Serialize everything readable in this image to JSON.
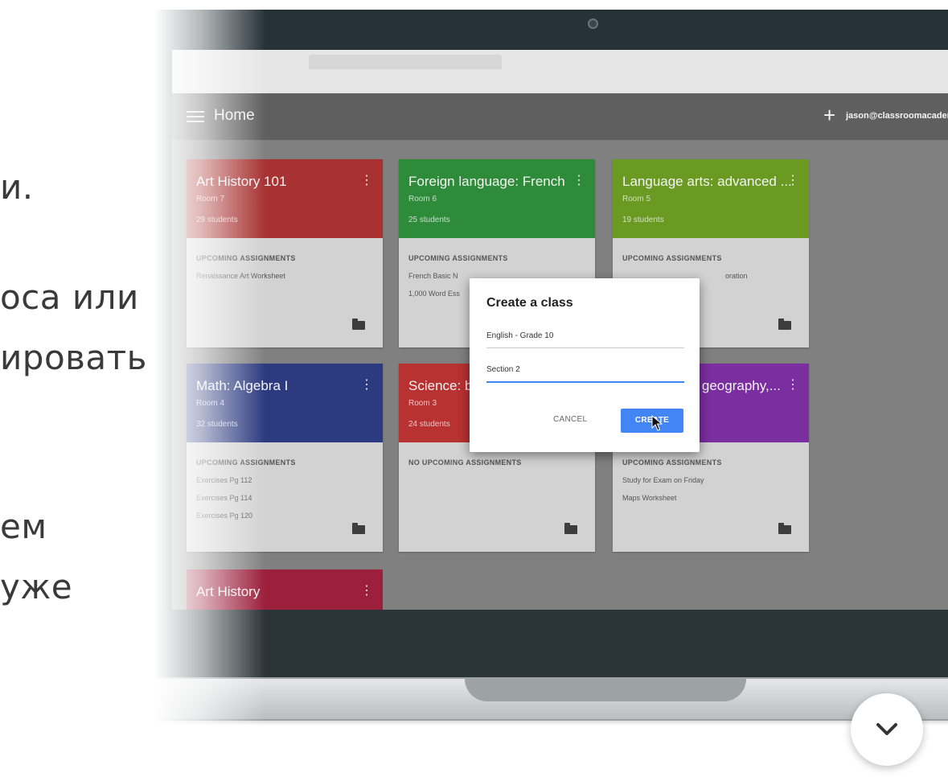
{
  "promo": {
    "lines": [
      "и.",
      "оса или",
      "ировать",
      "ем",
      "уже"
    ]
  },
  "app": {
    "title": "Home",
    "account": "jason@classroomacadem",
    "appbar_color": "#5f5f5f"
  },
  "cards": [
    {
      "title": "Art History 101",
      "room": "Room 7",
      "students": "29 students",
      "color": "#a83232",
      "section_head": "UPCOMING ASSIGNMENTS",
      "items": [
        "Renaissance Art Worksheet"
      ]
    },
    {
      "title": "Foreign language: French",
      "room": "Room 6",
      "students": "25 students",
      "color": "#2e8b3a",
      "section_head": "UPCOMING ASSIGNMENTS",
      "items": [
        "French Basic N",
        "1,000 Word Ess"
      ]
    },
    {
      "title": "Language arts: advanced ...",
      "room": "Room 5",
      "students": "19 students",
      "color": "#6a9a22",
      "section_head": "UPCOMING ASSIGNMENTS",
      "items": [
        "oration"
      ]
    },
    {
      "title": "Math: Algebra I",
      "room": "Room 4",
      "students": "32 students",
      "color": "#2c3a80",
      "section_head": "UPCOMING ASSIGNMENTS",
      "items": [
        "Exercises Pg 112",
        "Exercises Pg 114",
        "Exercises Pg 120"
      ]
    },
    {
      "title": "Science: b",
      "room": "Room 3",
      "students": "24 students",
      "color": "#b83232",
      "section_head": "NO UPCOMING ASSIGNMENTS",
      "items": []
    },
    {
      "title": "n: geography,...",
      "room": "",
      "students": "",
      "color": "#7b2ea0",
      "section_head": "UPCOMING ASSIGNMENTS",
      "items": [
        "Study for Exam on Friday",
        "Maps Worksheet"
      ]
    },
    {
      "title": "Art History",
      "color": "#9c1f3c"
    }
  ],
  "dialog": {
    "title": "Create a class",
    "field1_value": "English - Grade 10",
    "field2_value": "Section 2",
    "cancel_label": "CANCEL",
    "create_label": "CREATE",
    "accent": "#4285f4"
  },
  "colors": {
    "lid": "#263238",
    "scroll_button": "#ffffff"
  },
  "icons": {
    "menu": "menu-icon",
    "add": "plus-icon",
    "more": "more-vert-icon",
    "folder": "folder-icon",
    "cursor": "cursor-icon",
    "scroll": "chevron-down-icon"
  }
}
